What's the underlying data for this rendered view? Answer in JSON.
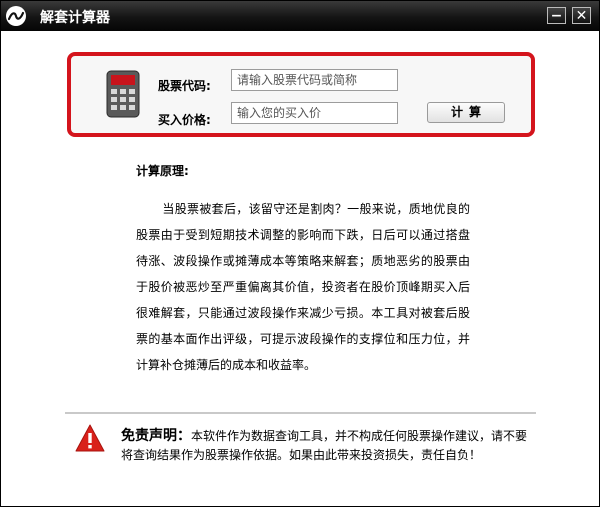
{
  "window": {
    "title": "解套计算器",
    "minimize_label": "−",
    "close_label": "✕"
  },
  "form": {
    "code_label": "股票代码:",
    "code_placeholder": "请输入股票代码或简称",
    "price_label": "买入价格:",
    "price_placeholder": "输入您的买入价",
    "calculate_label": "计算"
  },
  "principle": {
    "title": "计算原理:",
    "body": "当股票被套后，该留守还是割肉？一般来说，质地优良的股票由于受到短期技术调整的影响而下跌，日后可以通过搭盘待涨、波段操作或摊薄成本等策略来解套；质地恶劣的股票由于股价被恶炒至严重偏离其价值，投资者在股价顶峰期买入后很难解套，只能通过波段操作来减少亏损。本工具对被套后股票的基本面作出评级，可提示波段操作的支撑位和压力位，并计算补仓摊薄后的成本和收益率。"
  },
  "disclaimer": {
    "title": "免责声明：",
    "text": "本软件作为数据查询工具，并不构成任何股票操作建议，请不要将查询结果作为股票操作依据。如果由此带来投资损失，责任自负！"
  },
  "icons": {
    "app": "app-logo-icon",
    "calculator": "calculator-icon",
    "warning": "warning-icon"
  },
  "colors": {
    "title_bar": "#111111",
    "panel_border": "#d4141c",
    "warning": "#d9211b"
  }
}
